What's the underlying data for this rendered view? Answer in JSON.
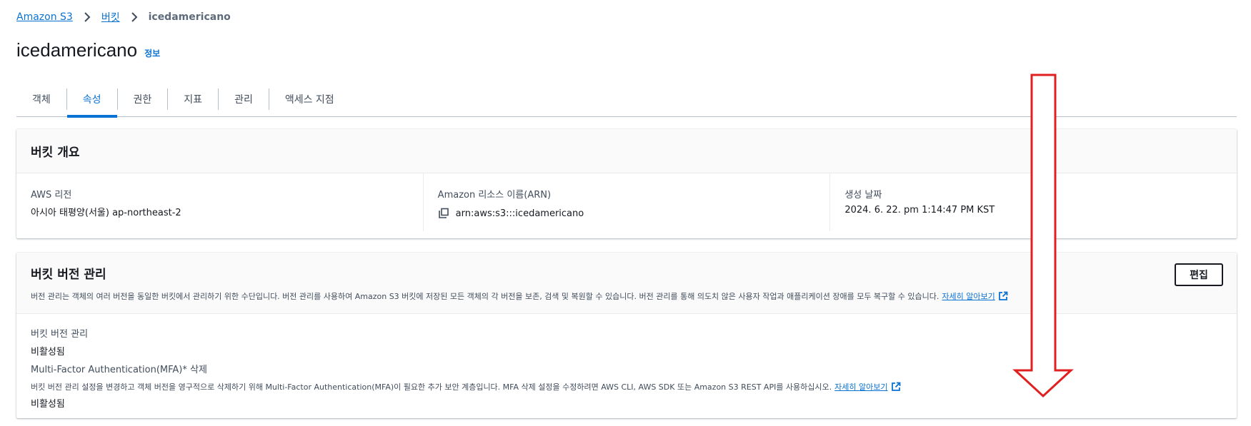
{
  "breadcrumb": {
    "items": [
      "Amazon S3",
      "버킷"
    ],
    "current": "icedamericano"
  },
  "header": {
    "title": "icedamericano",
    "info": "정보"
  },
  "tabs": [
    {
      "label": "객체",
      "active": false
    },
    {
      "label": "속성",
      "active": true
    },
    {
      "label": "권한",
      "active": false
    },
    {
      "label": "지표",
      "active": false
    },
    {
      "label": "관리",
      "active": false
    },
    {
      "label": "액세스 지점",
      "active": false
    }
  ],
  "overview": {
    "title": "버킷 개요",
    "region_label": "AWS 리전",
    "region_value": "아시아 태평양(서울) ap-northeast-2",
    "arn_label": "Amazon 리소스 이름(ARN)",
    "arn_value": "arn:aws:s3:::icedamericano",
    "created_label": "생성 날짜",
    "created_value": "2024. 6. 22. pm 1:14:47 PM KST"
  },
  "versioning": {
    "title": "버킷 버전 관리",
    "description": "버전 관리는 객체의 여러 버전을 동일한 버킷에서 관리하기 위한 수단입니다. 버전 관리를 사용하여 Amazon S3 버킷에 저장된 모든 객체의 각 버전을 보존, 검색 및 복원할 수 있습니다. 버전 관리를 통해 의도치 않은 사용자 작업과 애플리케이션 장애를 모두 복구할 수 있습니다.",
    "learn_more": "자세히 알아보기",
    "edit_label": "편집",
    "status_label": "버킷 버전 관리",
    "status_value": "비활성됨",
    "mfa_label": "Multi-Factor Authentication(MFA)* 삭제",
    "mfa_description": "버킷 버전 관리 설정을 변경하고 객체 버전을 영구적으로 삭제하기 위해 Multi-Factor Authentication(MFA)이 필요한 추가 보안 계층입니다. MFA 삭제 설정을 수정하려면 AWS CLI, AWS SDK 또는 Amazon S3 REST API를 사용하십시오.",
    "mfa_learn_more": "자세히 알아보기",
    "mfa_value": "비활성됨"
  },
  "colors": {
    "link": "#0972d3",
    "annotation_arrow": "#e02020"
  }
}
